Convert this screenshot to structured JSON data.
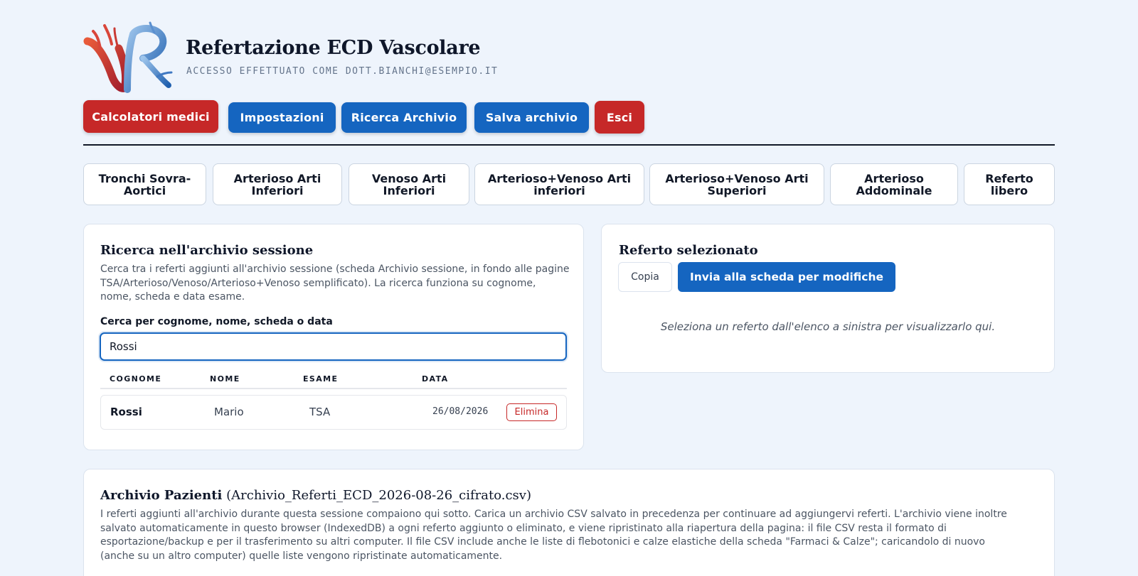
{
  "header": {
    "title": "Refertazione ECD Vascolare",
    "subtitle": "ACCESSO EFFETTUATO COME DOTT.BIANCHI@ESEMPIO.IT",
    "logo_icon": "vascular-vr-logo-icon"
  },
  "toolbar": {
    "calculators": "Calcolatori medici",
    "settings": "Impostazioni",
    "search_archive": "Ricerca Archivio",
    "save_archive": "Salva archivio",
    "logout": "Esci"
  },
  "tabs": [
    "Tronchi Sovra-Aortici",
    "Arterioso Arti Inferiori",
    "Venoso Arti Inferiori",
    "Arterioso+Venoso Arti inferiori",
    "Arterioso+Venoso Arti Superiori",
    "Arterioso Addominale",
    "Referto libero"
  ],
  "search_panel": {
    "title": "Ricerca nell'archivio sessione",
    "description": "Cerca tra i referti aggiunti all'archivio sessione (scheda Archivio sessione, in fondo alle pagine TSA/Arterioso/Venoso/Arterioso+Venoso semplificato). La ricerca funziona su cognome, nome, scheda e data esame.",
    "search_label": "Cerca per cognome, nome, scheda o data",
    "search_value": "Rossi",
    "columns": [
      "COGNOME",
      "NOME",
      "ESAME",
      "DATA"
    ],
    "rows": [
      {
        "cognome": "Rossi",
        "nome": "Mario",
        "esame": "TSA",
        "data": "26/08/2026",
        "delete_label": "Elimina"
      }
    ]
  },
  "selected_panel": {
    "title": "Referto selezionato",
    "copy_label": "Copia",
    "send_label": "Invia alla scheda per modifiche",
    "empty_message": "Seleziona un referto dall'elenco a sinistra per visualizzarlo qui."
  },
  "archive_panel": {
    "title": "Archivio Pazienti",
    "file": "(Archivio_Referti_ECD_2026-08-26_cifrato.csv)",
    "description": "I referti aggiunti all'archivio durante questa sessione compaiono qui sotto. Carica un archivio CSV salvato in precedenza per continuare ad aggiungervi referti. L'archivio viene inoltre salvato automaticamente in questo browser (IndexedDB) a ogni referto aggiunto o eliminato, e viene ripristinato alla riapertura della pagina: il file CSV resta il formato di esportazione/backup e per il trasferimento su altri computer. Il file CSV include anche le liste di flebotonici e calze elastiche della scheda \"Farmaci & Calze\"; caricandolo di nuovo (anche su un altro computer) quelle liste vengono ripristinate automaticamente."
  },
  "colors": {
    "primary_blue": "#1565c0",
    "danger_red": "#c62828",
    "background": "#eef4fc"
  }
}
